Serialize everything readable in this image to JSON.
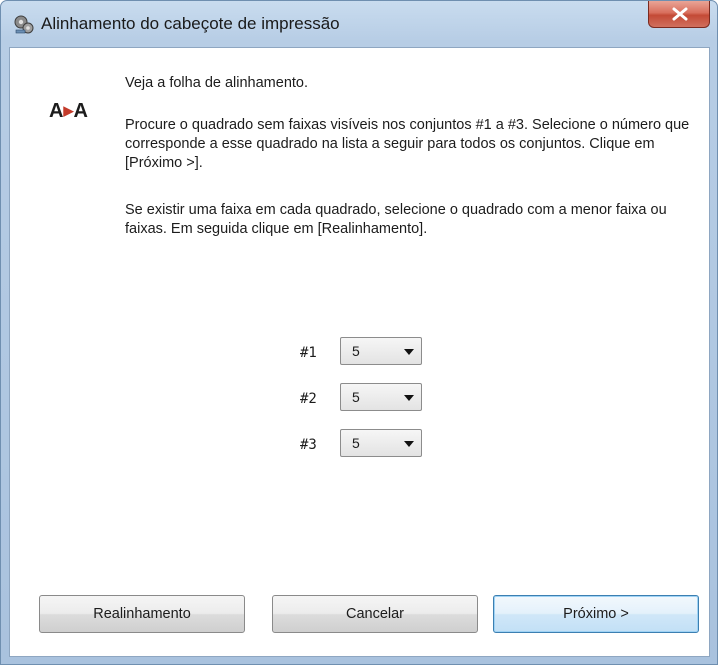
{
  "window": {
    "title": "Alinhamento do cabeçote de impressão",
    "icon": "printer-gears-icon",
    "close_icon": "close-icon"
  },
  "logo": {
    "left": "A",
    "right": "A",
    "icon": "alignment-icon"
  },
  "instructions": {
    "line1": "Veja a folha de alinhamento.",
    "paragraph1": "Procure o quadrado sem faixas visíveis nos conjuntos #1 a #3. Selecione o número que corresponde a esse quadrado na lista a seguir para todos os conjuntos. Clique em [Próximo >].",
    "paragraph2": "Se existir uma faixa em cada quadrado, selecione o quadrado com a menor faixa ou faixas. Em seguida clique em [Realinhamento]."
  },
  "sets": [
    {
      "label": "#1",
      "value": "5"
    },
    {
      "label": "#2",
      "value": "5"
    },
    {
      "label": "#3",
      "value": "5"
    }
  ],
  "buttons": {
    "realign": "Realinhamento",
    "cancel": "Cancelar",
    "next": "Próximo >"
  },
  "colors": {
    "frame": "#b7cde5",
    "close": "#c44a36",
    "default_button_border": "#3c7fb1",
    "logo_arrow": "#c33a2a"
  }
}
